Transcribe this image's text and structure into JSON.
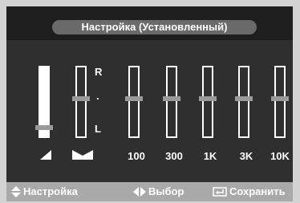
{
  "title": "Настройка (Установленный)",
  "balance": {
    "top_label": "R",
    "mid_label": ".",
    "bottom_label": "L"
  },
  "eq_bands": [
    {
      "label": "100",
      "level": 0.5
    },
    {
      "label": "300",
      "level": 0.5
    },
    {
      "label": "1K",
      "level": 0.5
    },
    {
      "label": "3K",
      "level": 0.5
    },
    {
      "label": "10K",
      "level": 0.5
    }
  ],
  "volume": {
    "level": 0.1
  },
  "footer": {
    "adjust_label": "Настройка",
    "select_label": "Выбор",
    "save_label": "Сохранить"
  },
  "colors": {
    "panel": "#2f2f2f",
    "header": "#1e1e1e",
    "footer": "#a9a9a9",
    "outer": "#d3d3d3"
  }
}
